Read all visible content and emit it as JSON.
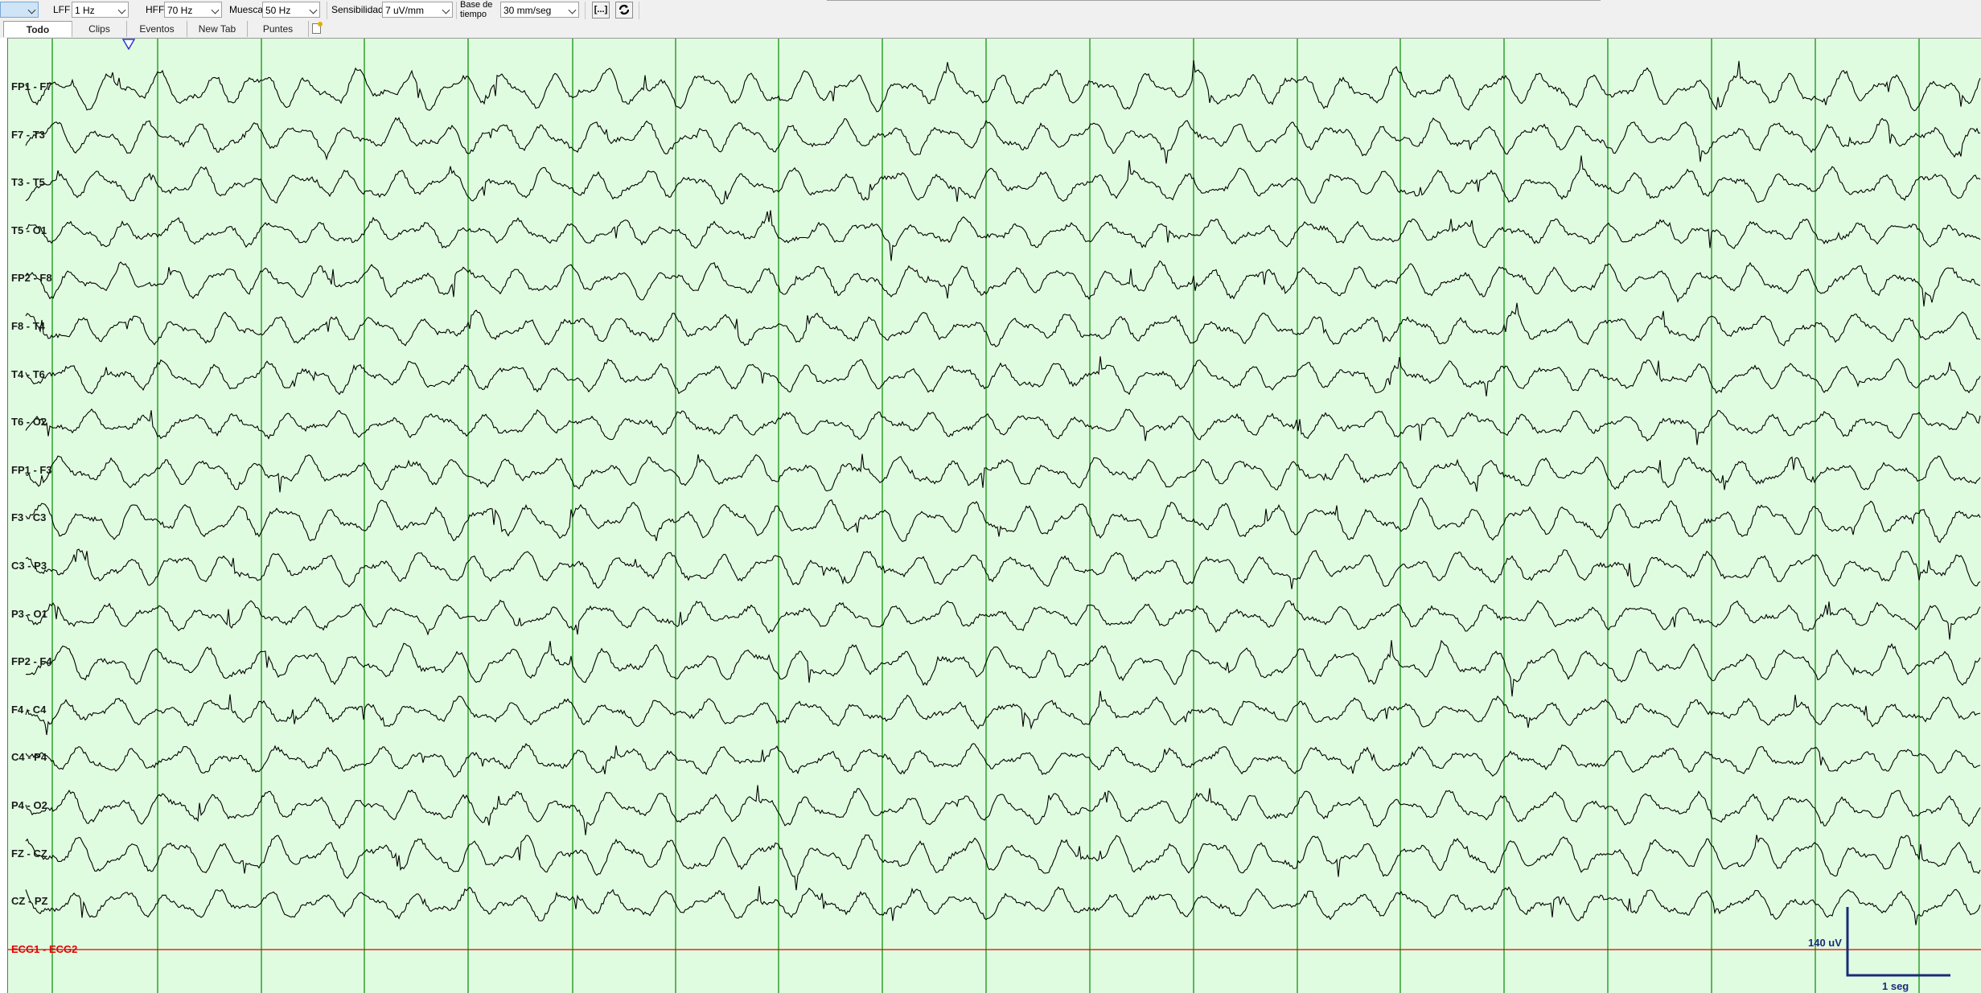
{
  "toolbar": {
    "lff_label": "LFF",
    "lff_value": "1 Hz",
    "hff_label": "HFF",
    "hff_value": "70 Hz",
    "notch_label": "Muesca",
    "notch_value": "50 Hz",
    "sensitivity_label": "Sensibilidad",
    "sensitivity_value": "7 uV/mm",
    "timebase_label_1": "Base de",
    "timebase_label_2": "tiempo",
    "timebase_value": "30 mm/seg",
    "bracket_button": "[...]"
  },
  "tabs": [
    "Todo",
    "Clips",
    "Eventos",
    "New Tab",
    "Puntes"
  ],
  "active_tab": "Todo",
  "channels": [
    "FP1 - F7",
    "F7 - T3",
    "T3 - T5",
    "T5 - O1",
    "FP2 - F8",
    "F8 - T4",
    "T4 - T6",
    "T6 - O2",
    "FP1 - F3",
    "F3 - C3",
    "C3 - P3",
    "P3 - O1",
    "FP2 - F4",
    "F4 - C4",
    "C4 - P4",
    "P4 - O2",
    "FZ - CZ",
    "CZ - PZ"
  ],
  "ecg_channel": "ECG1 - ECG2",
  "scale": {
    "amplitude": "140 uV",
    "time": "1 seg"
  },
  "colors": {
    "background": "#e0fce0",
    "grid": "#2ea02e",
    "trace": "#000000",
    "ecg": "#e00000",
    "scale": "#1a2a7a"
  }
}
